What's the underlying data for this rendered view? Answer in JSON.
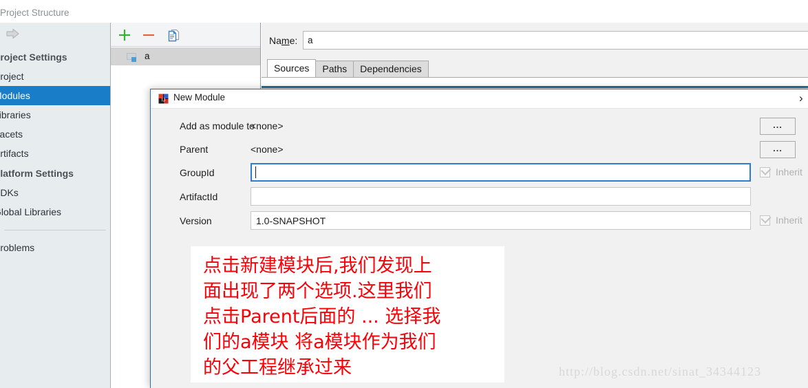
{
  "window": {
    "title": "Project Structure"
  },
  "sidebar": {
    "arrow_icon": "right-arrow-icon",
    "items": [
      {
        "label": "Project Settings",
        "type": "group"
      },
      {
        "label": "Project",
        "type": "item"
      },
      {
        "label": "Modules",
        "type": "item",
        "selected": true
      },
      {
        "label": "Libraries",
        "type": "item"
      },
      {
        "label": "Facets",
        "type": "item"
      },
      {
        "label": "Artifacts",
        "type": "item"
      },
      {
        "label": "Platform Settings",
        "type": "group"
      },
      {
        "label": "SDKs",
        "type": "item"
      },
      {
        "label": "Global Libraries",
        "type": "item"
      },
      {
        "label": "Problems",
        "type": "item"
      }
    ],
    "selected_color": "#1a7dc8",
    "background_color": "#e7ecef"
  },
  "modules_panel": {
    "toolbar": {
      "add_icon": "plus-icon",
      "remove_icon": "minus-icon",
      "copy_icon": "copy-icon",
      "add_color": "#33b333",
      "remove_color": "#e1613a",
      "copy_color": "#3a7fc4"
    },
    "tree": {
      "rows": [
        {
          "label": "a",
          "icon": "module-icon",
          "selected": true
        }
      ],
      "selected_background": "#d4d4d4"
    }
  },
  "content": {
    "name_label_pre": "Na",
    "name_label_mnemonic": "m",
    "name_label_post": "e:",
    "name_value": "a",
    "name_placeholder": "",
    "tabs": [
      {
        "label": "Sources",
        "active": true
      },
      {
        "label": "Paths",
        "active": false
      },
      {
        "label": "Dependencies",
        "active": false
      }
    ]
  },
  "dialog": {
    "title": "New Module",
    "app_icon": "intellij-idea-icon",
    "chevron_icon": "chevron-right-icon",
    "fields": [
      {
        "label": "Add as module to",
        "kind": "static",
        "value": "<none>",
        "action_label": "...",
        "action_icon": "ellipsis-button"
      },
      {
        "label": "Parent",
        "kind": "static",
        "value": "<none>",
        "action_label": "...",
        "action_icon": "ellipsis-button"
      },
      {
        "label": "GroupId",
        "kind": "input",
        "value": "",
        "placeholder": "",
        "focused": true,
        "inherit_label": "Inherit",
        "inherit_checked": true,
        "inherit_enabled": false
      },
      {
        "label": "ArtifactId",
        "kind": "input",
        "value": "",
        "placeholder": "",
        "focused": false
      },
      {
        "label": "Version",
        "kind": "input",
        "value": "1.0-SNAPSHOT",
        "placeholder": "",
        "focused": false,
        "inherit_label": "Inherit",
        "inherit_checked": true,
        "inherit_enabled": false
      }
    ]
  },
  "annotation": {
    "text": "点击新建模块后,我们发现上\n面出现了两个选项.这里我们\n点击Parent后面的 ... 选择我\n们的a模块 将a模块作为我们\n的父工程继承过来",
    "color": "#fb0007"
  },
  "watermark": {
    "text": "http://blog.csdn.net/sinat_34344123"
  }
}
